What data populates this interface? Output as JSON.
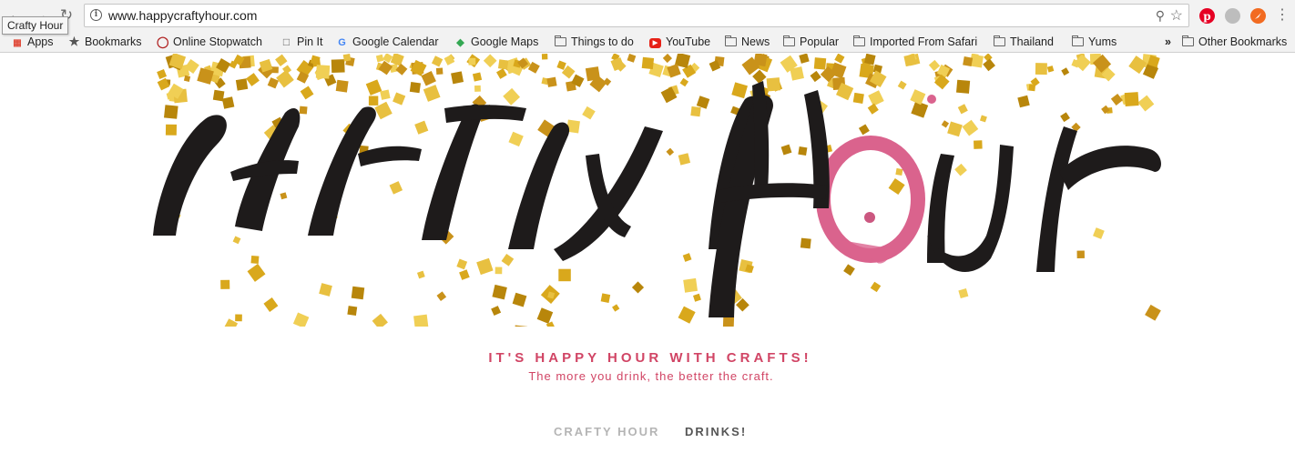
{
  "tooltip": "Crafty Hour",
  "address_bar": {
    "url": "www.happycraftyhour.com"
  },
  "bookmarks": {
    "items": [
      {
        "label": "Apps",
        "icon": "apps-grid-icon"
      },
      {
        "label": "Bookmarks",
        "icon": "star-icon"
      },
      {
        "label": "Online Stopwatch",
        "icon": "stopwatch-icon"
      },
      {
        "label": "Pin It",
        "icon": "page-icon"
      },
      {
        "label": "Google Calendar",
        "icon": "google-icon"
      },
      {
        "label": "Google Maps",
        "icon": "maps-icon"
      },
      {
        "label": "Things to do",
        "icon": "folder-icon"
      },
      {
        "label": "YouTube",
        "icon": "youtube-icon"
      },
      {
        "label": "News",
        "icon": "folder-icon"
      },
      {
        "label": "Popular",
        "icon": "folder-icon"
      },
      {
        "label": "Imported From Safari",
        "icon": "folder-icon"
      },
      {
        "label": "Thailand",
        "icon": "folder-icon"
      },
      {
        "label": "Yums",
        "icon": "folder-icon"
      }
    ],
    "overflow": "»",
    "other": "Other Bookmarks"
  },
  "page": {
    "tagline": "IT'S HAPPY HOUR WITH CRAFTS!",
    "subtagline": "The more you drink, the better the craft.",
    "nav": [
      {
        "label": "CRAFTY HOUR",
        "active": false
      },
      {
        "label": "DRINKS!",
        "active": true
      }
    ]
  },
  "colors": {
    "accent": "#d14565",
    "glitter": "#d9a81c",
    "nav_inactive": "#b5b5b5",
    "nav_active": "#555555",
    "wine_stain": "#d4487a"
  }
}
